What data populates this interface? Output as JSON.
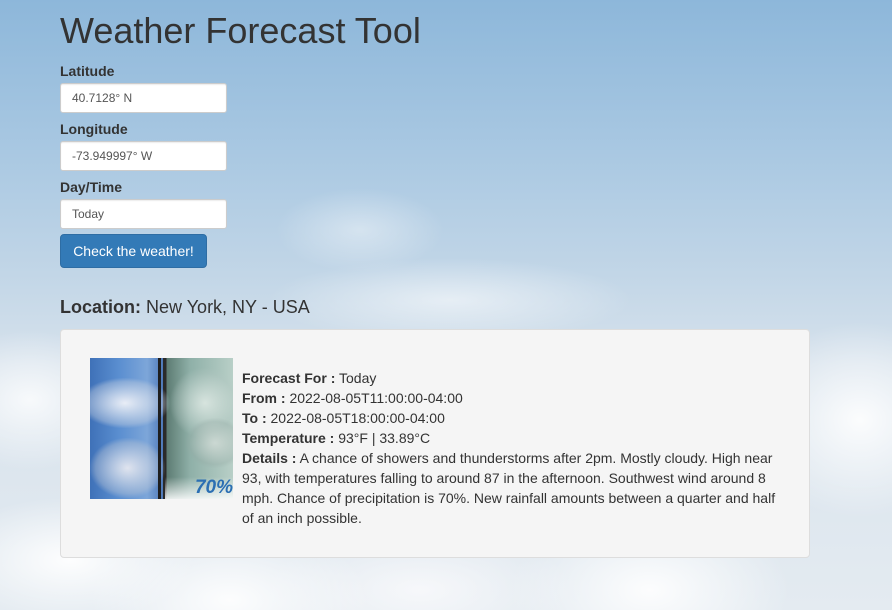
{
  "title": "Weather Forecast Tool",
  "form": {
    "latitude_label": "Latitude",
    "latitude_value": "40.7128° N",
    "longitude_label": "Longitude",
    "longitude_value": "-73.949997° W",
    "daytime_label": "Day/Time",
    "daytime_value": "Today",
    "submit_label": "Check the weather!"
  },
  "location": {
    "label": "Location:",
    "value": "New York, NY - USA"
  },
  "forecast": {
    "image_icon": "showers-thunderstorms-icon",
    "image_percent": "70%",
    "forecast_for_label": "Forecast For :",
    "forecast_for_value": "Today",
    "from_label": "From :",
    "from_value": "2022-08-05T11:00:00-04:00",
    "to_label": "To :",
    "to_value": "2022-08-05T18:00:00-04:00",
    "temperature_label": "Temperature :",
    "temperature_value": "93°F | 33.89°C",
    "details_label": "Details :",
    "details_value": "A chance of showers and thunderstorms after 2pm. Mostly cloudy. High near 93, with temperatures falling to around 87 in the afternoon. Southwest wind around 8 mph. Chance of precipitation is 70%. New rainfall amounts between a quarter and half of an inch possible."
  },
  "colors": {
    "primary_button": "#337ab7",
    "panel_background": "#f5f5f5",
    "text": "#333333"
  }
}
